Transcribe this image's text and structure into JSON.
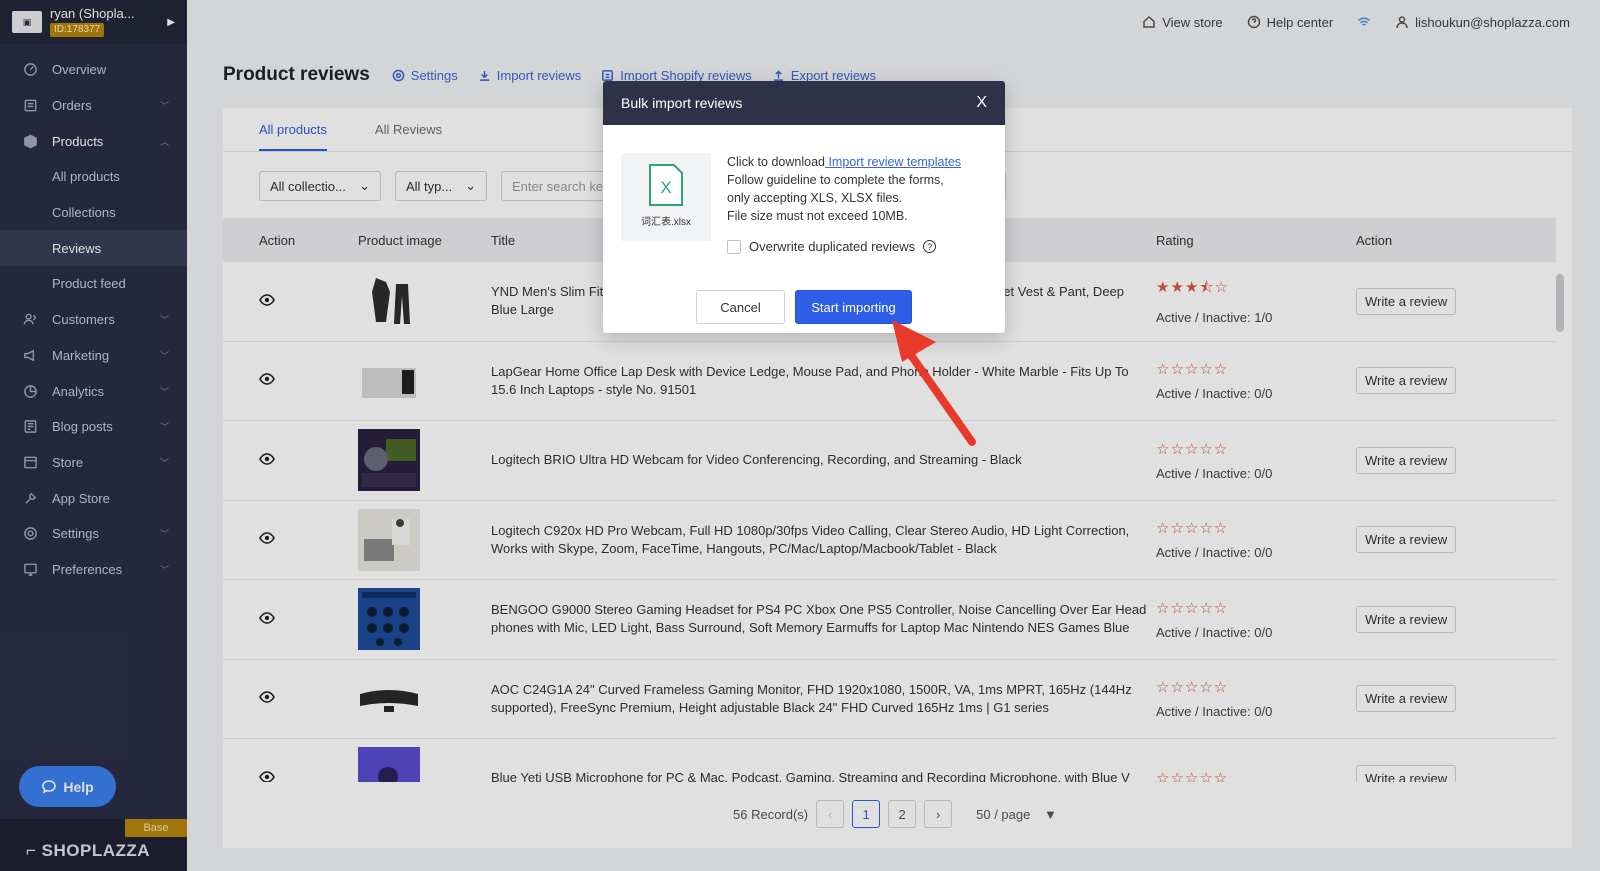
{
  "sidebar": {
    "shop_name": "ryan (Shopla...",
    "shop_id": "ID:178377",
    "items": [
      {
        "label": "Overview",
        "icon": "overview-icon",
        "chevron": false
      },
      {
        "label": "Orders",
        "icon": "orders-icon",
        "chevron": true
      },
      {
        "label": "Products",
        "icon": "products-icon",
        "chevron": true,
        "expanded": true
      },
      {
        "label": "All products",
        "sub": true
      },
      {
        "label": "Collections",
        "sub": true
      },
      {
        "label": "Reviews",
        "sub": true,
        "selected": true
      },
      {
        "label": "Product feed",
        "sub": true
      },
      {
        "label": "Customers",
        "icon": "customers-icon",
        "chevron": true
      },
      {
        "label": "Marketing",
        "icon": "marketing-icon",
        "chevron": true
      },
      {
        "label": "Analytics",
        "icon": "analytics-icon",
        "chevron": true
      },
      {
        "label": "Blog posts",
        "icon": "blog-icon",
        "chevron": true
      },
      {
        "label": "Store",
        "icon": "store-icon",
        "chevron": true
      },
      {
        "label": "App Store",
        "icon": "app-store-icon",
        "chevron": false
      },
      {
        "label": "Settings",
        "icon": "settings-icon",
        "chevron": true
      },
      {
        "label": "Preferences",
        "icon": "preferences-icon",
        "chevron": true
      }
    ],
    "help_label": "Help",
    "plan_badge": "Base",
    "brand": "SHOPLAZZA"
  },
  "topbar": {
    "view_store": "View store",
    "help_center": "Help center",
    "user_email": "lishoukun@shoplazza.com"
  },
  "header": {
    "title": "Product reviews",
    "settings": "Settings",
    "import_reviews": "Import reviews",
    "import_shopify": "Import Shopify reviews",
    "export_reviews": "Export reviews"
  },
  "tabs": [
    "All products",
    "All Reviews"
  ],
  "filters": {
    "collection": "All collectio...",
    "type": "All typ...",
    "search_placeholder": "Enter search keywords"
  },
  "table": {
    "columns": [
      "Action",
      "Product image",
      "Title",
      "Rating",
      "Action"
    ],
    "rows": [
      {
        "title": "YND Men's Slim Fit Suit, One Button 2-Piece Blazer Dress Business Wedding Party Jacket Vest & Pant, Deep Blue Large",
        "rating": 3.5,
        "status": "Active / Inactive: 1/0",
        "img": "suit"
      },
      {
        "title": "LapGear Home Office Lap Desk with Device Ledge, Mouse Pad, and Phone Holder - White Marble - Fits Up To 15.6 Inch Laptops - style No. 91501",
        "rating": 0,
        "status": "Active / Inactive: 0/0",
        "img": "desk"
      },
      {
        "title": "Logitech BRIO Ultra HD Webcam for Video Conferencing, Recording, and Streaming - Black",
        "rating": 0,
        "status": "Active / Inactive: 0/0",
        "img": "webcam"
      },
      {
        "title": "Logitech C920x HD Pro Webcam, Full HD 1080p/30fps Video Calling, Clear Stereo Audio, HD Light Correction, Works with Skype, Zoom, FaceTime, Hangouts, PC/Mac/Laptop/Macbook/Tablet - Black",
        "rating": 0,
        "status": "Active / Inactive: 0/0",
        "img": "laptop"
      },
      {
        "title": "BENGOO G9000 Stereo Gaming Headset for PS4 PC Xbox One PS5 Controller, Noise Cancelling Over Ear Head phones with Mic, LED Light, Bass Surround, Soft Memory Earmuffs for Laptop Mac Nintendo NES Games Blue",
        "rating": 0,
        "status": "Active / Inactive: 0/0",
        "img": "headset"
      },
      {
        "title": "AOC C24G1A 24\" Curved Frameless Gaming Monitor, FHD 1920x1080, 1500R, VA, 1ms MPRT, 165Hz (144Hz supported), FreeSync Premium, Height adjustable Black 24\" FHD Curved 165Hz 1ms | G1 series",
        "rating": 0,
        "status": "Active / Inactive: 0/0",
        "img": "monitor"
      },
      {
        "title": "Blue Yeti USB Microphone for PC & Mac, Podcast, Gaming, Streaming and Recording Microphone, with Blue V",
        "rating": 0,
        "status": "",
        "img": "mic"
      }
    ],
    "write_review": "Write a review"
  },
  "pager": {
    "records": "56 Record(s)",
    "pages": [
      "1",
      "2"
    ],
    "per_page": "50 / page"
  },
  "modal": {
    "title": "Bulk import reviews",
    "close": "X",
    "file_name": "词汇表.xlsx",
    "line1_prefix": "Click to download",
    "line1_link": " Import review templates",
    "line2": "Follow guideline to complete the forms,",
    "line3": "only accepting XLS, XLSX files.",
    "line4": "File size must not exceed 10MB.",
    "overwrite": "Overwrite duplicated reviews",
    "cancel": "Cancel",
    "start": "Start importing"
  },
  "colors": {
    "accent": "#2e5ee8",
    "sidebar": "#2b2e45",
    "star": "#d9573e",
    "arrow": "#e8392a"
  }
}
